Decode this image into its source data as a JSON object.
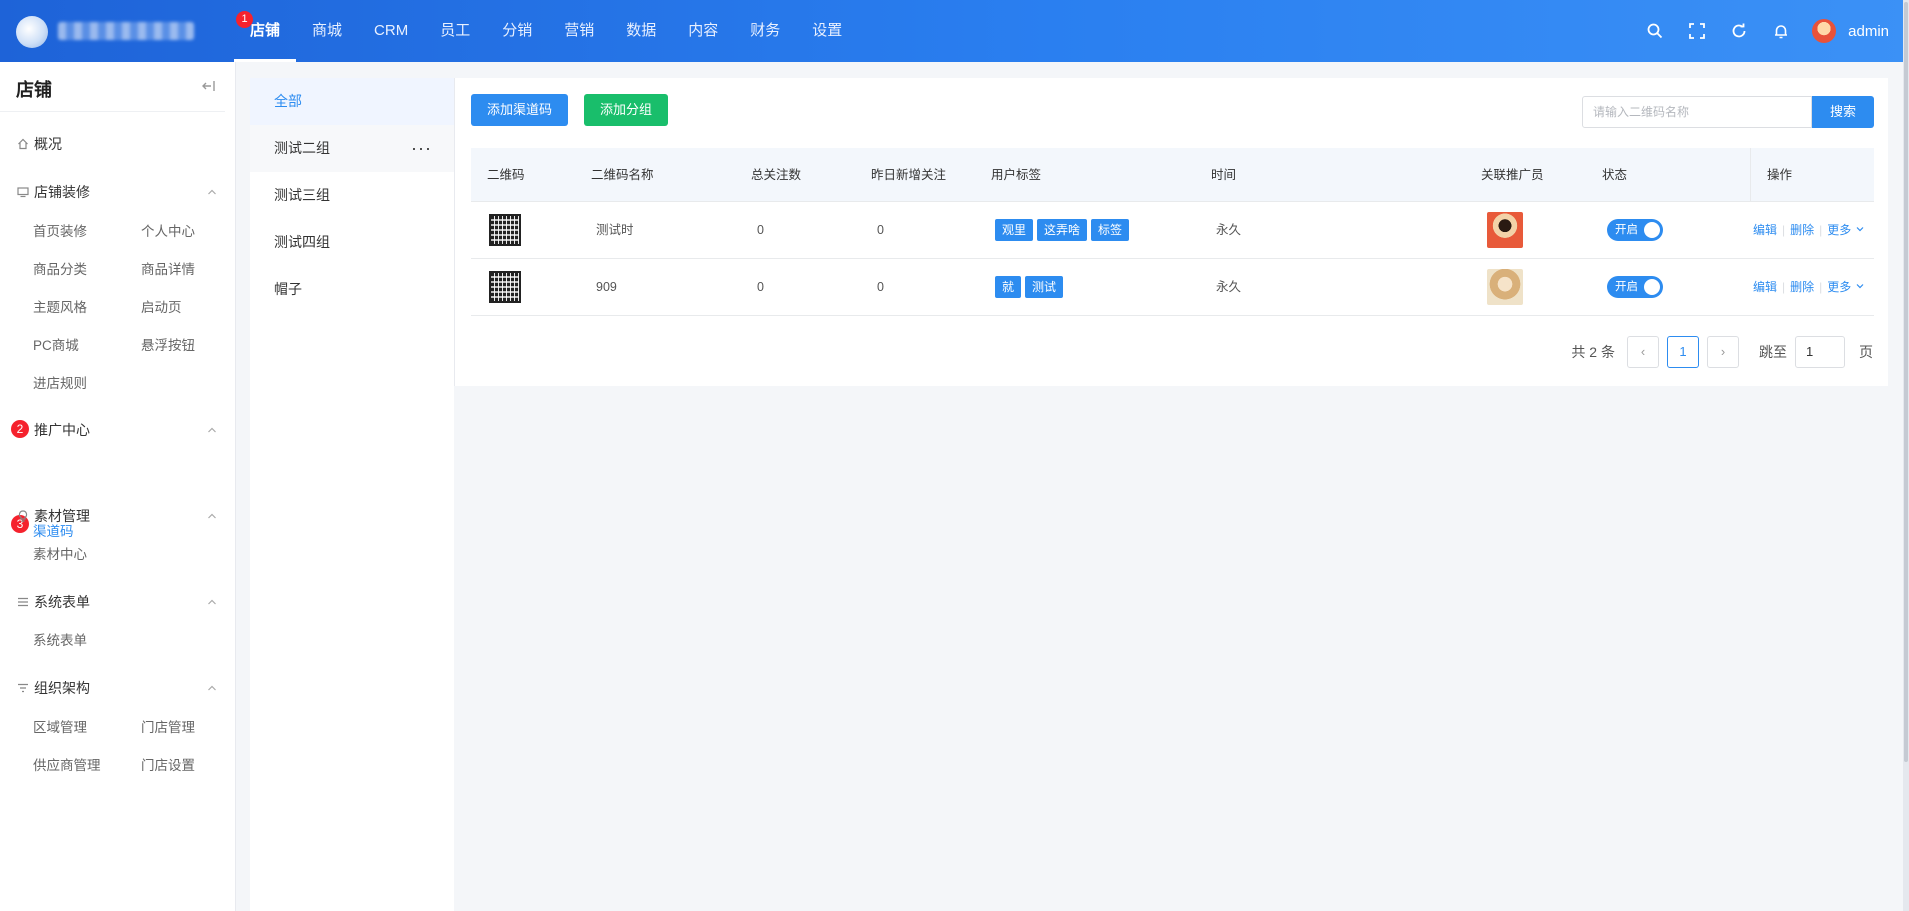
{
  "topbar": {
    "nav": [
      {
        "label": "店铺",
        "active": true,
        "badge": "1"
      },
      {
        "label": "商城"
      },
      {
        "label": "CRM"
      },
      {
        "label": "员工"
      },
      {
        "label": "分销"
      },
      {
        "label": "营销"
      },
      {
        "label": "数据"
      },
      {
        "label": "内容"
      },
      {
        "label": "财务"
      },
      {
        "label": "设置"
      }
    ],
    "user_name": "admin",
    "icons": [
      "search-icon",
      "fullscreen-icon",
      "refresh-icon",
      "bell-icon"
    ]
  },
  "sidebar": {
    "title": "店铺",
    "overview": "概况",
    "groups": [
      {
        "title": "店铺装修",
        "icon": "monitor-icon",
        "items": [
          "首页装修",
          "个人中心",
          "商品分类",
          "商品详情",
          "主题风格",
          "启动页",
          "PC商城",
          "悬浮按钮",
          "进店规则"
        ]
      },
      {
        "title": "推广中心",
        "badge": "2",
        "items": [
          "渠道码"
        ],
        "active_item": "渠道码",
        "active_badge": "3"
      },
      {
        "title": "素材管理",
        "icon": "bulb-icon",
        "items": [
          "素材中心"
        ]
      },
      {
        "title": "系统表单",
        "icon": "list-icon",
        "items": [
          "系统表单"
        ]
      },
      {
        "title": "组织架构",
        "icon": "filter-icon",
        "items": [
          "区域管理",
          "门店管理",
          "供应商管理",
          "门店设置"
        ]
      }
    ]
  },
  "group_list": {
    "items": [
      "全部",
      "测试二组",
      "测试三组",
      "测试四组",
      "帽子"
    ],
    "active": "全部",
    "more": "···"
  },
  "toolbar": {
    "add_code_label": "添加渠道码",
    "add_group_label": "添加分组",
    "search_placeholder": "请输入二维码名称",
    "search_label": "搜索"
  },
  "table": {
    "headers": [
      "二维码",
      "二维码名称",
      "总关注数",
      "昨日新增关注",
      "用户标签",
      "时间",
      "关联推广员",
      "状态",
      "操作"
    ],
    "rows": [
      {
        "name": "测试时",
        "total": "0",
        "yesterday": "0",
        "tags": [
          "观里",
          "这弄啥",
          "标签"
        ],
        "time": "永久",
        "status": "开启"
      },
      {
        "name": "909",
        "total": "0",
        "yesterday": "0",
        "tags": [
          "就",
          "测试"
        ],
        "time": "永久",
        "status": "开启"
      }
    ],
    "ops": {
      "edit": "编辑",
      "delete": "删除",
      "more": "更多"
    }
  },
  "pagination": {
    "total_text": "共 2 条",
    "current_page": "1",
    "jump_label": "跳至",
    "jump_value": "1",
    "unit": "页",
    "prev": "‹",
    "next": "›"
  },
  "colors": {
    "primary": "#2d8cf0",
    "success": "#19be6b",
    "danger": "#f5222d"
  }
}
